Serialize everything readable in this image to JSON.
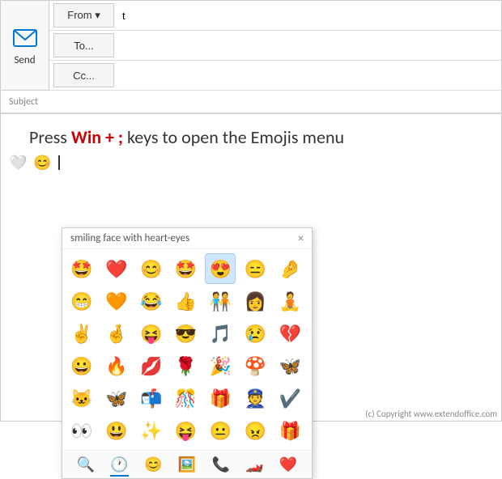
{
  "header": {
    "send_label": "Send",
    "from_label": "From ▾",
    "to_label": "To...",
    "cc_label": "Cc...",
    "subject_label": "Subject",
    "from_value": "t"
  },
  "body": {
    "instruction_part1": "Press ",
    "instruction_key": "Win + ;",
    "instruction_part2": " keys to open the Emojis menu",
    "cursor_line": "|"
  },
  "emoji_panel": {
    "title": "smiling face with heart-eyes",
    "close_label": "×",
    "emojis": [
      "🤩",
      "❤️",
      "😊",
      "🤩",
      "😍",
      "😑",
      "🤌",
      "😁",
      "🧡",
      "😂",
      "👍",
      "🧑‍🤝‍🧑",
      "👩",
      "🧘",
      "✌️",
      "🤞",
      "😝",
      "😎",
      "🎵",
      "😢",
      "💔",
      "😀",
      "🔥",
      "💋",
      "🌹",
      "🎉",
      "🍄",
      "🦋",
      "🐱",
      "🦋",
      "📬",
      "🎊",
      "🎁",
      "👮",
      "✔️",
      "👀",
      "😃",
      "✨",
      "😝",
      "😐",
      "😠",
      "🎁"
    ],
    "footer_icons": [
      "🔍",
      "🕐",
      "😊",
      "🖼️",
      "📞",
      "🏎️",
      "❤️"
    ]
  },
  "copyright": "(c) Copyright www.extendoffice.com"
}
